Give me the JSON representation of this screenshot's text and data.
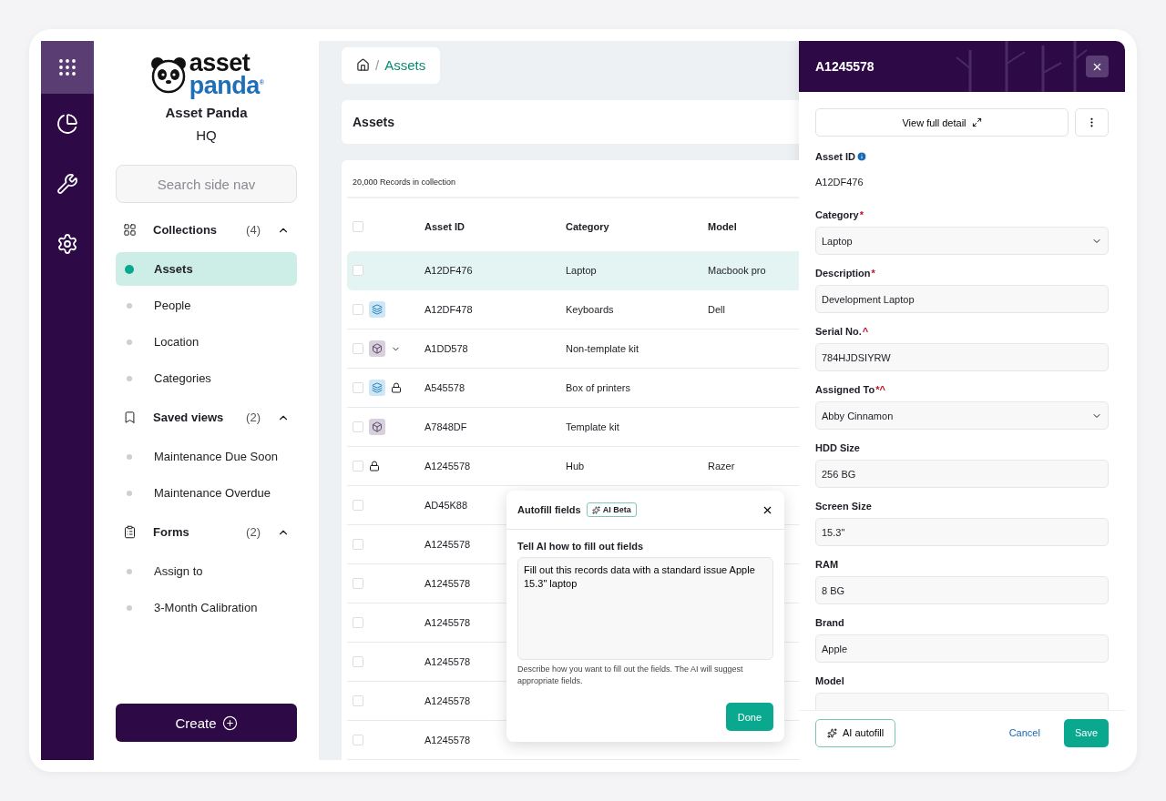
{
  "rail": [
    {
      "kind": "apps",
      "selected": true
    },
    {
      "kind": "reports",
      "selected": false
    },
    {
      "kind": "tools",
      "selected": false
    },
    {
      "kind": "settings",
      "selected": false
    }
  ],
  "brand": {
    "logo_top": "asset",
    "logo_bottom": "panda",
    "logo_mark": "®",
    "name": "Asset Panda",
    "site": "HQ"
  },
  "sidebar": {
    "search": {
      "placeholder": "Search side nav"
    },
    "groups": [
      {
        "kind": "collections",
        "label": "Collections",
        "count": "(4)",
        "expanded": true,
        "items": [
          {
            "label": "Assets",
            "selected": true
          },
          {
            "label": "People",
            "selected": false
          },
          {
            "label": "Location",
            "selected": false
          },
          {
            "label": "Categories",
            "selected": false
          }
        ]
      },
      {
        "kind": "views",
        "label": "Saved views",
        "count": "(2)",
        "expanded": true,
        "items": [
          {
            "label": "Maintenance Due Soon",
            "selected": false
          },
          {
            "label": "Maintenance Overdue",
            "selected": false
          }
        ]
      },
      {
        "kind": "forms",
        "label": "Forms",
        "count": "(2)",
        "expanded": true,
        "items": [
          {
            "label": "Assign to",
            "selected": false
          },
          {
            "label": "3-Month Calibration",
            "selected": false
          }
        ]
      }
    ],
    "create_button": "Create"
  },
  "breadcrumb": {
    "separator": "/",
    "items": [
      "Assets"
    ]
  },
  "page_title": "Assets",
  "table": {
    "record_count": "20,000 Records in collection",
    "all_checked": false,
    "columns": [
      "Asset ID",
      "Category",
      "Model"
    ],
    "rows": [
      {
        "selected": true,
        "checked": false,
        "locked": false,
        "expandable": false,
        "cells": [
          "A12DF476",
          "Laptop",
          "Macbook pro"
        ]
      },
      {
        "selected": false,
        "checked": false,
        "kind": "stack",
        "locked": false,
        "expandable": false,
        "cells": [
          "A12DF478",
          "Keyboards",
          "Dell"
        ]
      },
      {
        "selected": false,
        "checked": false,
        "kind": "kit",
        "locked": false,
        "expandable": true,
        "cells": [
          "A1DD578",
          "Non-template kit",
          ""
        ]
      },
      {
        "selected": false,
        "checked": false,
        "kind": "stack",
        "locked": true,
        "expandable": false,
        "cells": [
          "A545578",
          "Box of printers",
          ""
        ]
      },
      {
        "selected": false,
        "checked": false,
        "kind": "kit",
        "locked": false,
        "expandable": false,
        "cells": [
          "A7848DF",
          "Template kit",
          ""
        ]
      },
      {
        "selected": false,
        "checked": false,
        "locked": true,
        "expandable": false,
        "cells": [
          "A1245578",
          "Hub",
          "Razer"
        ]
      },
      {
        "selected": false,
        "checked": false,
        "locked": false,
        "expandable": false,
        "cells": [
          "AD45K88",
          "",
          ""
        ]
      },
      {
        "selected": false,
        "checked": false,
        "locked": false,
        "expandable": false,
        "cells": [
          "A1245578",
          "",
          ""
        ]
      },
      {
        "selected": false,
        "checked": false,
        "locked": false,
        "expandable": false,
        "cells": [
          "A1245578",
          "",
          ""
        ]
      },
      {
        "selected": false,
        "checked": false,
        "locked": false,
        "expandable": false,
        "cells": [
          "A1245578",
          "",
          ""
        ]
      },
      {
        "selected": false,
        "checked": false,
        "locked": false,
        "expandable": false,
        "cells": [
          "A1245578",
          "",
          ""
        ]
      },
      {
        "selected": false,
        "checked": false,
        "locked": false,
        "expandable": false,
        "cells": [
          "A1245578",
          "",
          ""
        ]
      },
      {
        "selected": false,
        "checked": false,
        "locked": false,
        "expandable": false,
        "cells": [
          "A1245578",
          "",
          ""
        ]
      }
    ]
  },
  "autofill": {
    "title": "Autofill fields",
    "badge": "AI Beta",
    "prompt_label": "Tell AI how to fill out fields",
    "prompt": "Fill out this records data with a standard issue Apple 15.3\" laptop",
    "hint": "Describe how you want to fill out the fields. The AI will suggest appropriate fields.",
    "done": "Done"
  },
  "detail": {
    "title": "A1245578",
    "view_button": "View full detail",
    "fields": [
      {
        "kind": "static",
        "label": "Asset ID",
        "info": true,
        "value": "A12DF476"
      },
      {
        "kind": "select",
        "label": "Category",
        "marker": "*",
        "value": "Laptop"
      },
      {
        "kind": "input",
        "label": "Description",
        "marker": "*",
        "value": "Development Laptop"
      },
      {
        "kind": "input",
        "label": "Serial No.",
        "marker": "^",
        "value": "784HJDSIYRW"
      },
      {
        "kind": "select",
        "label": "Assigned To",
        "marker": "*^",
        "value": "Abby Cinnamon"
      },
      {
        "kind": "input",
        "label": "HDD Size",
        "value": "256 BG"
      },
      {
        "kind": "input",
        "label": "Screen Size",
        "value": "15.3\""
      },
      {
        "kind": "input",
        "label": "RAM",
        "value": "8 BG"
      },
      {
        "kind": "input",
        "label": "Brand",
        "value": "Apple"
      },
      {
        "kind": "input",
        "label": "Model"
      }
    ],
    "ai_button": "AI autofill",
    "cancel": "Cancel",
    "save": "Save"
  }
}
